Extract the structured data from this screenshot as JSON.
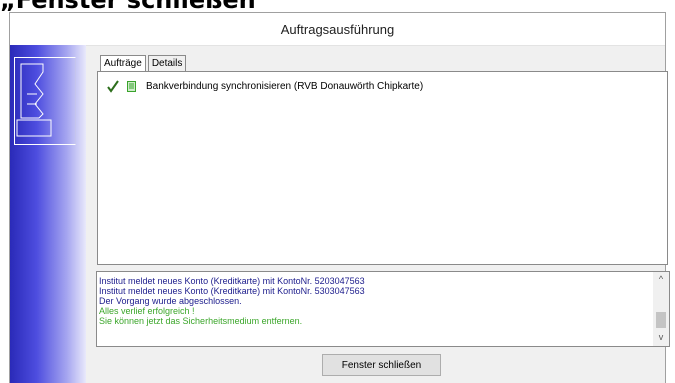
{
  "caption": "„Fenster schließen",
  "window": {
    "title": "Auftragsausführung"
  },
  "tabs": [
    {
      "label": "Aufträge",
      "active": true
    },
    {
      "label": "Details",
      "active": false
    }
  ],
  "jobs": [
    {
      "label": "Bankverbindung synchronisieren (RVB Donauwörth Chipkarte)",
      "status_icon": "checkmark-icon",
      "type_icon": "document-icon"
    }
  ],
  "log": {
    "lines": [
      {
        "text": "Institut meldet neues Konto (Kreditkarte) mit KontoNr. 5203047563",
        "color": "#1c1c8c"
      },
      {
        "text": "Institut meldet neues Konto (Kreditkarte) mit KontoNr. 5303047563",
        "color": "#1c1c8c"
      },
      {
        "text": "Der Vorgang wurde abgeschlossen.",
        "color": "#1c1c8c"
      },
      {
        "text": "Alles verlief erfolgreich !",
        "color": "#3ba62a"
      },
      {
        "text": "Sie können jetzt das Sicherheitsmedium entfernen.",
        "color": "#3ba62a"
      }
    ]
  },
  "buttons": {
    "close_label": "Fenster schließen"
  }
}
